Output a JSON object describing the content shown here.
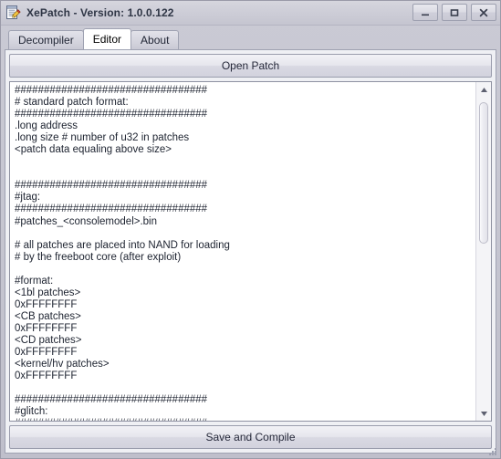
{
  "window": {
    "title": "XePatch - Version: 1.0.0.122",
    "icon": "notepad-pencil-icon",
    "controls": {
      "minimize_label": "minimize-icon",
      "maximize_label": "maximize-icon",
      "close_label": "close-icon"
    },
    "colors": {
      "titlebar": "#cdcdd7",
      "frame": "#c6c6d1",
      "panel": "#eff0f4",
      "editor_bg": "#ffffff",
      "text": "#1d2330",
      "border": "#9fa2b2"
    }
  },
  "tabs": [
    {
      "label": "Decompiler",
      "active": false
    },
    {
      "label": "Editor",
      "active": true
    },
    {
      "label": "About",
      "active": false
    }
  ],
  "editor_panel": {
    "open_button_label": "Open Patch",
    "save_button_label": "Save and Compile",
    "scrollbar": {
      "up_arrow": "scroll-up-icon",
      "down_arrow": "scroll-down-icon",
      "position": "top"
    },
    "content": "#################################\n# standard patch format:\n#################################\n.long address\n.long size # number of u32 in patches\n<patch data equaling above size>\n\n\n#################################\n#jtag:\n#################################\n#patches_<consolemodel>.bin\n\n# all patches are placed into NAND for loading\n# by the freeboot core (after exploit)\n\n#format:\n<1bl patches>\n0xFFFFFFFF\n<CB patches>\n0xFFFFFFFF\n<CD patches>\n0xFFFFFFFF\n<kernel/hv patches>\n0xFFFFFFFF\n\n#################################\n#glitch:\n#################################"
  }
}
